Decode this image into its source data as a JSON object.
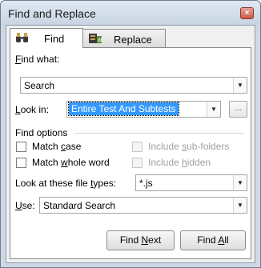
{
  "window": {
    "title": "Find and Replace",
    "close_glyph": "×"
  },
  "tabs": [
    {
      "label": "Find",
      "icon": "binoculars-icon",
      "active": true
    },
    {
      "label": "Replace",
      "icon": "replace-icon",
      "active": false
    }
  ],
  "find_what": {
    "label_prefix": "",
    "label_mnemonic": "F",
    "label_rest": "ind what:",
    "value": "Search"
  },
  "look_in": {
    "label_mnemonic": "L",
    "label_rest": "ook in:",
    "value": "Entire Test And Subtests",
    "browse_label": "..."
  },
  "find_options": {
    "title": "Find options",
    "match_case": {
      "prefix": "Match ",
      "mnemonic": "c",
      "rest": "ase",
      "checked": false
    },
    "match_whole_word": {
      "prefix": "Match ",
      "mnemonic": "w",
      "rest": "hole word",
      "checked": false
    },
    "include_subfolders": {
      "prefix": "Include ",
      "mnemonic": "s",
      "rest": "ub-folders",
      "enabled": false
    },
    "include_hidden": {
      "prefix": "Include ",
      "mnemonic": "h",
      "rest": "idden",
      "enabled": false
    }
  },
  "file_types": {
    "prefix": "Look at these file ",
    "mnemonic": "t",
    "rest": "ypes:",
    "value": "*.js"
  },
  "use": {
    "mnemonic": "U",
    "rest": "se:",
    "value": "Standard Search"
  },
  "buttons": {
    "find_next": {
      "prefix": "Find ",
      "mnemonic": "N",
      "rest": "ext"
    },
    "find_all": {
      "prefix": "Find ",
      "mnemonic": "A",
      "rest": "ll"
    }
  },
  "colors": {
    "selection": "#3399ff",
    "frame": "#cfd9e6"
  }
}
